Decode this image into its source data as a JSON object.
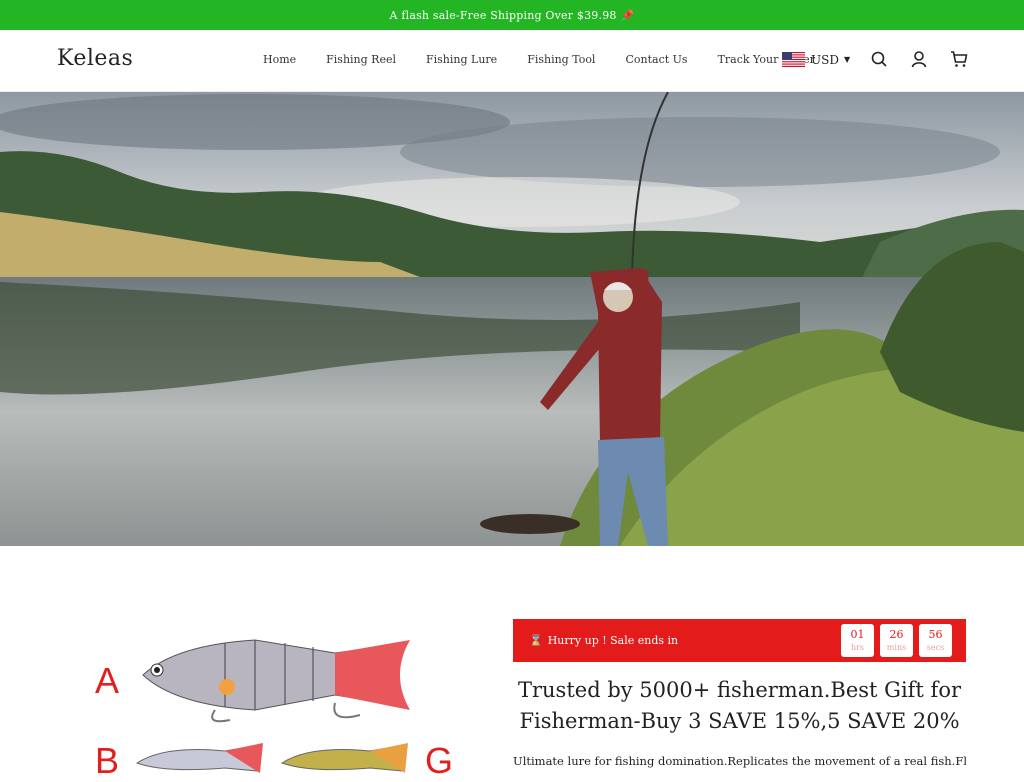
{
  "announcement": {
    "text": "A flash sale-Free Shipping Over $39.98",
    "icon": "pin-icon"
  },
  "header": {
    "logo": "Keleas",
    "nav": [
      "Home",
      "Fishing Reel",
      "Fishing Lure",
      "Fishing Tool",
      "Contact Us",
      "Track Your Order"
    ],
    "currency": "USD",
    "icons": [
      "search-icon",
      "account-icon",
      "cart-icon"
    ]
  },
  "hero": {
    "icon": "fisherman-landscape-image"
  },
  "product_image": {
    "letters": [
      "A",
      "B",
      "G"
    ]
  },
  "sale": {
    "label": "Hurry up ! Sale ends in",
    "hours": "01",
    "hours_label": "hrs",
    "minutes": "26",
    "minutes_label": "mins",
    "seconds": "56",
    "seconds_label": "secs"
  },
  "headline": "Trusted by 5000+ fisherman.Best Gift for Fisherman-Buy 3 SAVE 15%,5 SAVE 20%",
  "description": "Ultimate lure for fishing domination.Replicates the movement of a real fish.Flexible",
  "colors": {
    "topbar": "#24b524",
    "sale": "#e31b1b"
  }
}
